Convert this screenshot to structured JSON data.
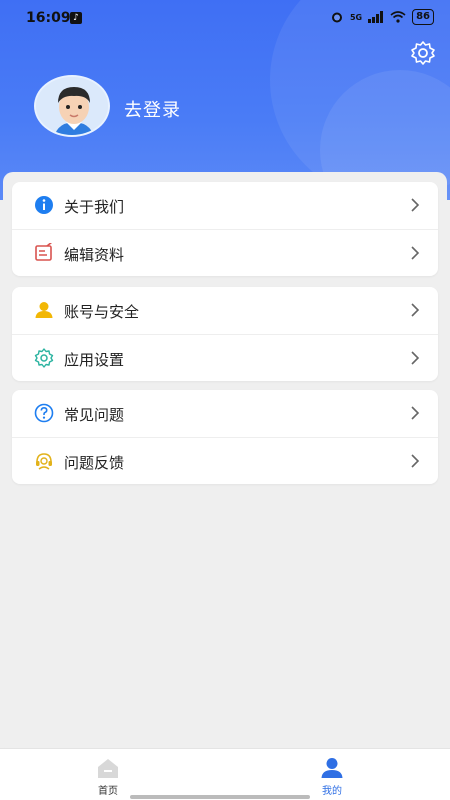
{
  "status_bar": {
    "time": "16:09",
    "network": "5G",
    "battery": "86"
  },
  "profile": {
    "login_label": "去登录"
  },
  "menu_groups": [
    {
      "items": [
        {
          "label": "关于我们",
          "icon": "info-icon"
        },
        {
          "label": "编辑资料",
          "icon": "edit-icon"
        }
      ]
    },
    {
      "items": [
        {
          "label": "账号与安全",
          "icon": "person-icon"
        },
        {
          "label": "应用设置",
          "icon": "gear-icon"
        }
      ]
    },
    {
      "items": [
        {
          "label": "常见问题",
          "icon": "question-icon"
        },
        {
          "label": "问题反馈",
          "icon": "headset-icon"
        }
      ]
    }
  ],
  "tab_bar": {
    "tabs": [
      {
        "label": "首页",
        "icon": "home-icon"
      },
      {
        "label": "我的",
        "icon": "profile-icon"
      }
    ],
    "active": "我的"
  },
  "colors": {
    "header_blue": "#3f6ff4",
    "accent_blue": "#2f6fe4",
    "info_blue": "#1e7ef0",
    "edit_red": "#d9534f",
    "person_yellow": "#f2b705",
    "gear_teal": "#2bb3a0"
  }
}
